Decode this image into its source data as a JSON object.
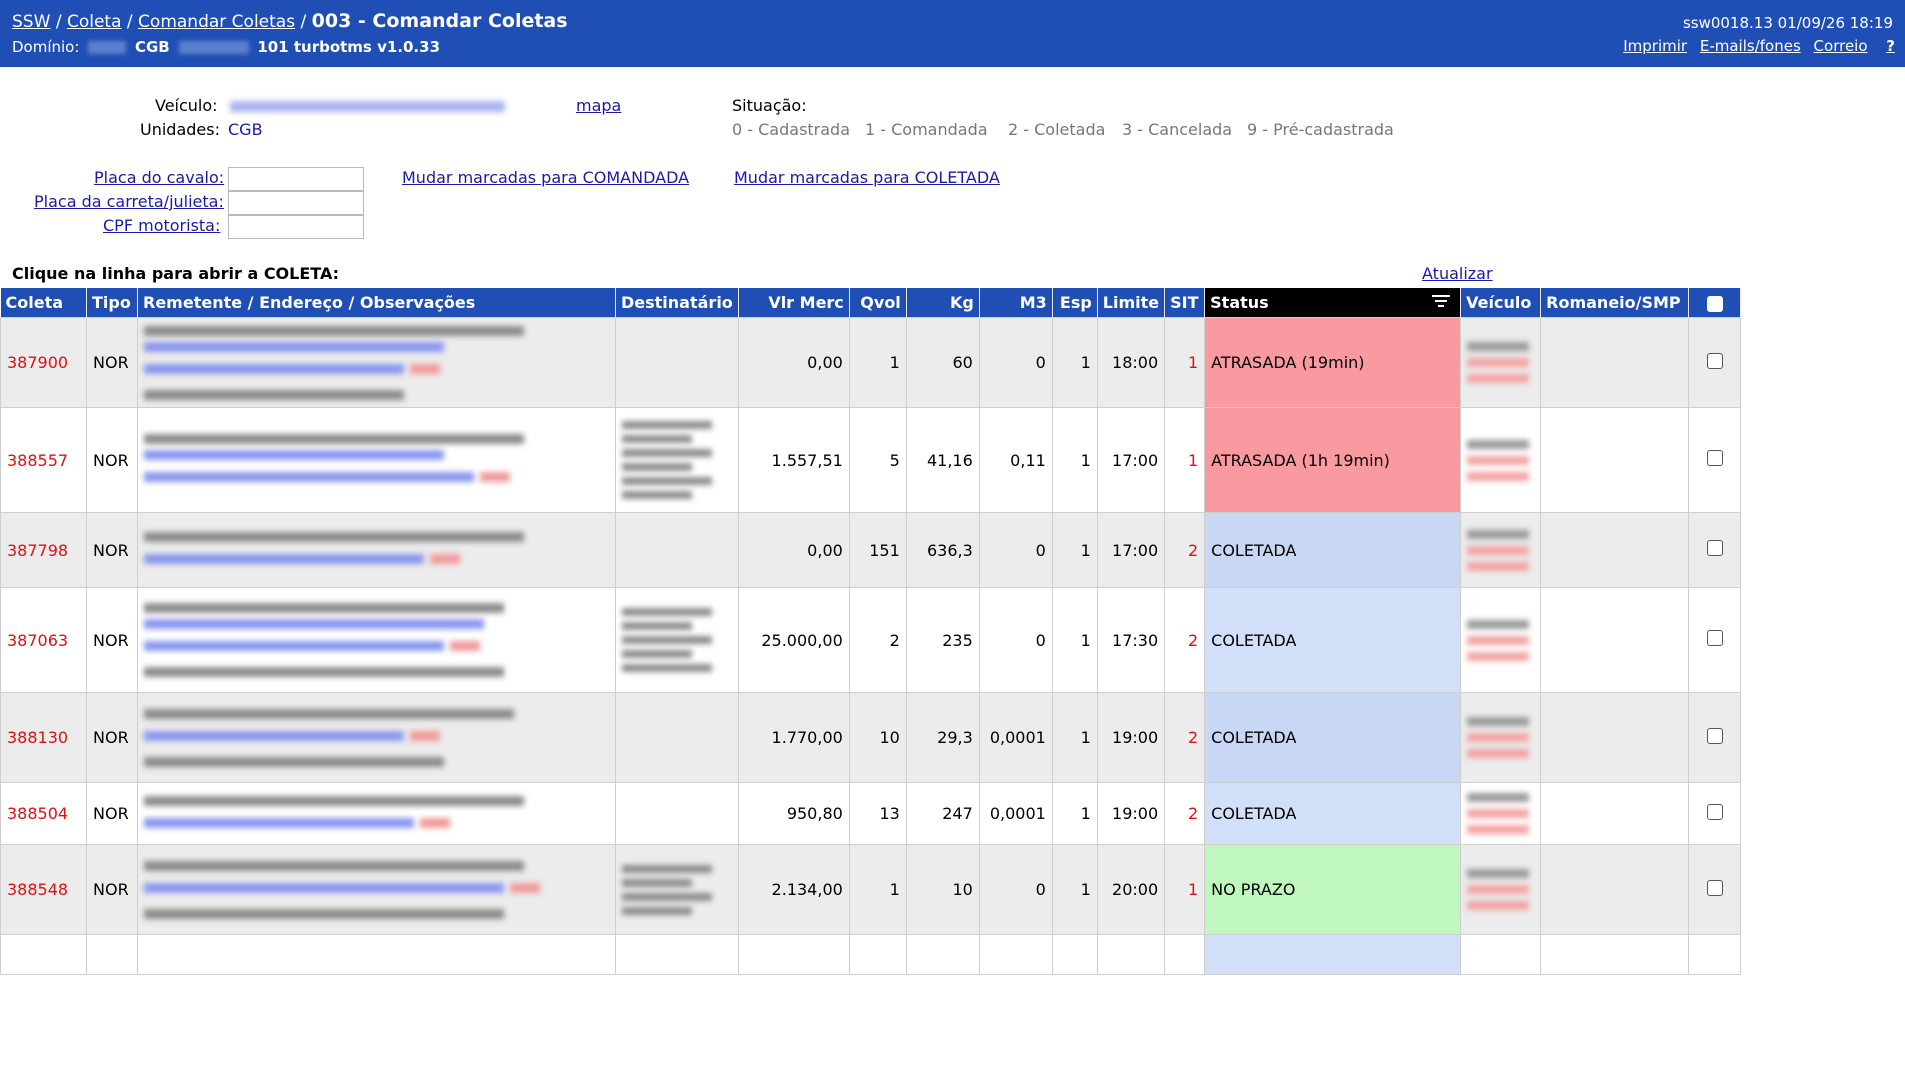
{
  "header": {
    "breadcrumb": [
      "SSW",
      "Coleta",
      "Comandar Coletas"
    ],
    "separator": "/",
    "title": "003 - Comandar Coletas",
    "domain_label": "Domínio:",
    "domain_code": "CGB",
    "domain_version": "101 turbotms v1.0.33",
    "sysinfo": "ssw0018.13 01/09/26 18:19",
    "links": [
      "Imprimir",
      "E-mails/fones",
      "Correio"
    ],
    "help": "?"
  },
  "filters": {
    "veiculo_label": "Veículo:",
    "mapa_link": "mapa",
    "unidades_label": "Unidades:",
    "unidades_value": "CGB",
    "situacao_label": "Situação:",
    "situacoes": [
      "0 - Cadastrada",
      "1 - Comandada",
      "2 - Coletada",
      "3 - Cancelada",
      "9 - Pré-cadastrada"
    ],
    "placa_cavalo_label": "Placa do cavalo:",
    "placa_carreta_label": "Placa da carreta/julieta:",
    "cpf_label": "CPF motorista:",
    "placa_cavalo_value": "",
    "placa_carreta_value": "",
    "cpf_value": "",
    "btn_comandada": "Mudar marcadas para COMANDADA",
    "btn_coletada": "Mudar marcadas para COLETADA"
  },
  "list": {
    "instruction": "Clique na linha para abrir a COLETA:",
    "refresh": "Atualizar",
    "columns": [
      "Coleta",
      "Tipo",
      "Remetente / Endereço / Observações",
      "Destinatário",
      "Vlr Merc",
      "Qvol",
      "Kg",
      "M3",
      "Esp",
      "Limite",
      "SIT",
      "Status",
      "Veículo",
      "Romaneio/SMP"
    ],
    "rows": [
      {
        "coleta": "387900",
        "tipo": "NOR",
        "vlr": "0,00",
        "qvol": "1",
        "kg": "60",
        "m3": "0",
        "esp": "1",
        "limite": "18:00",
        "sit": "1",
        "status": "ATRASADA (19min)",
        "state": "late"
      },
      {
        "coleta": "388557",
        "tipo": "NOR",
        "vlr": "1.557,51",
        "qvol": "5",
        "kg": "41,16",
        "m3": "0,11",
        "esp": "1",
        "limite": "17:00",
        "sit": "1",
        "status": "ATRASADA (1h 19min)",
        "state": "late"
      },
      {
        "coleta": "387798",
        "tipo": "NOR",
        "vlr": "0,00",
        "qvol": "151",
        "kg": "636,3",
        "m3": "0",
        "esp": "1",
        "limite": "17:00",
        "sit": "2",
        "status": "COLETADA",
        "state": "col"
      },
      {
        "coleta": "387063",
        "tipo": "NOR",
        "vlr": "25.000,00",
        "qvol": "2",
        "kg": "235",
        "m3": "0",
        "esp": "1",
        "limite": "17:30",
        "sit": "2",
        "status": "COLETADA",
        "state": "col"
      },
      {
        "coleta": "388130",
        "tipo": "NOR",
        "vlr": "1.770,00",
        "qvol": "10",
        "kg": "29,3",
        "m3": "0,0001",
        "esp": "1",
        "limite": "19:00",
        "sit": "2",
        "status": "COLETADA",
        "state": "col"
      },
      {
        "coleta": "388504",
        "tipo": "NOR",
        "vlr": "950,80",
        "qvol": "13",
        "kg": "247",
        "m3": "0,0001",
        "esp": "1",
        "limite": "19:00",
        "sit": "2",
        "status": "COLETADA",
        "state": "col"
      },
      {
        "coleta": "388548",
        "tipo": "NOR",
        "vlr": "2.134,00",
        "qvol": "1",
        "kg": "10",
        "m3": "0",
        "esp": "1",
        "limite": "20:00",
        "sit": "1",
        "status": "NO PRAZO",
        "state": "ok"
      }
    ]
  },
  "colors": {
    "header_bg": "#1f4fb5",
    "late": "#f99aa0",
    "collected": "#d2dff8",
    "on_time": "#bff7bf",
    "coleta_text": "#dd1111"
  },
  "icons": {
    "filter": "filter-icon"
  }
}
